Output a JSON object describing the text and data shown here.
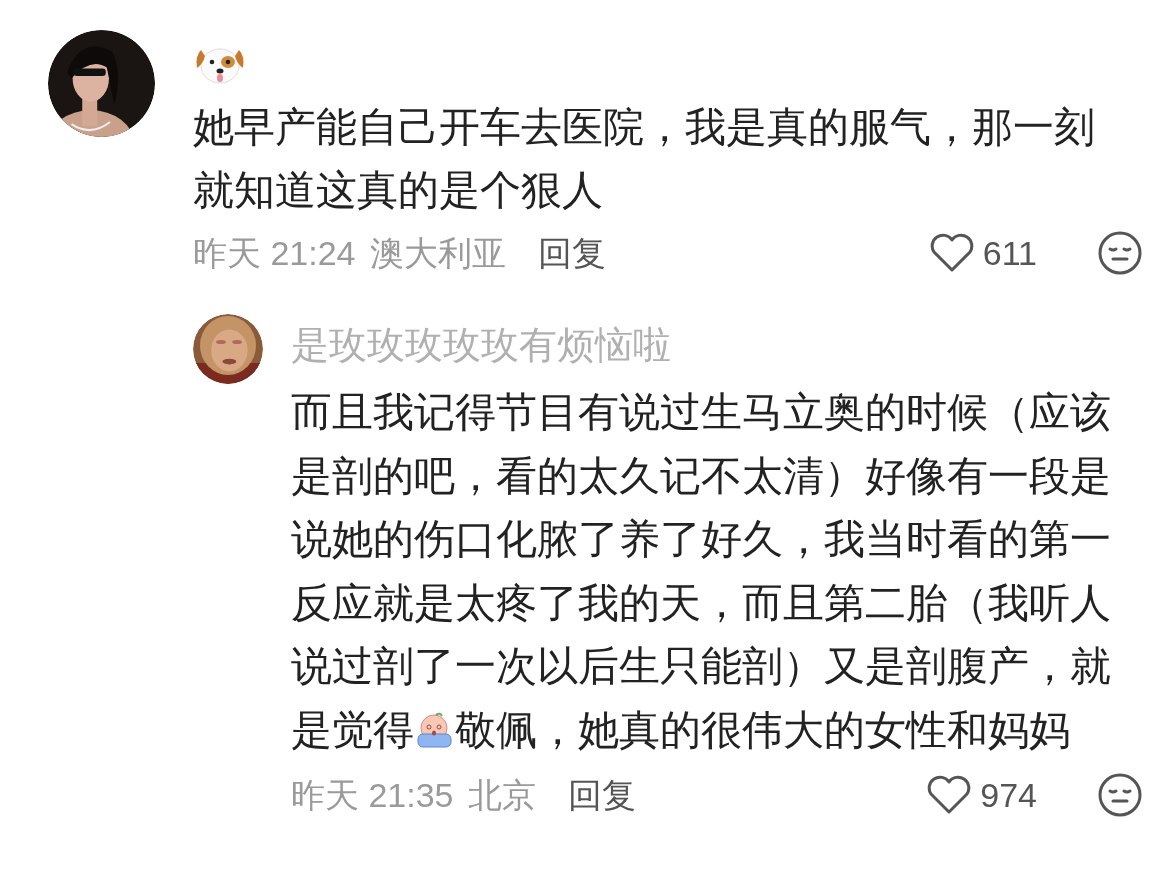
{
  "comments": [
    {
      "author_icon": {
        "kind": "dog"
      },
      "text": "她早产能自己开车去医院，我是真的服气，那一刻就知道这真的是个狠人",
      "time": "昨天 21:24",
      "location": "澳大利亚",
      "reply": "回复",
      "likes": "611",
      "replies": [
        {
          "author": "是玫玫玫玫玫有烦恼啦",
          "text": "而且我记得节目有说过生马立奥的时候（应该是剖的吧，看的太久记不太清）好像有一段是说她的伤口化脓了养了好久，我当时看的第一反应就是太疼了我的天，而且第二胎（我听人说过剖了一次以后生只能剖）又是剖腹产，就是觉得",
          "text_after_emoji": "敬佩，她真的很伟大的女性和妈妈",
          "time": "昨天 21:35",
          "location": "北京",
          "reply": "回复",
          "likes": "974"
        }
      ]
    }
  ]
}
